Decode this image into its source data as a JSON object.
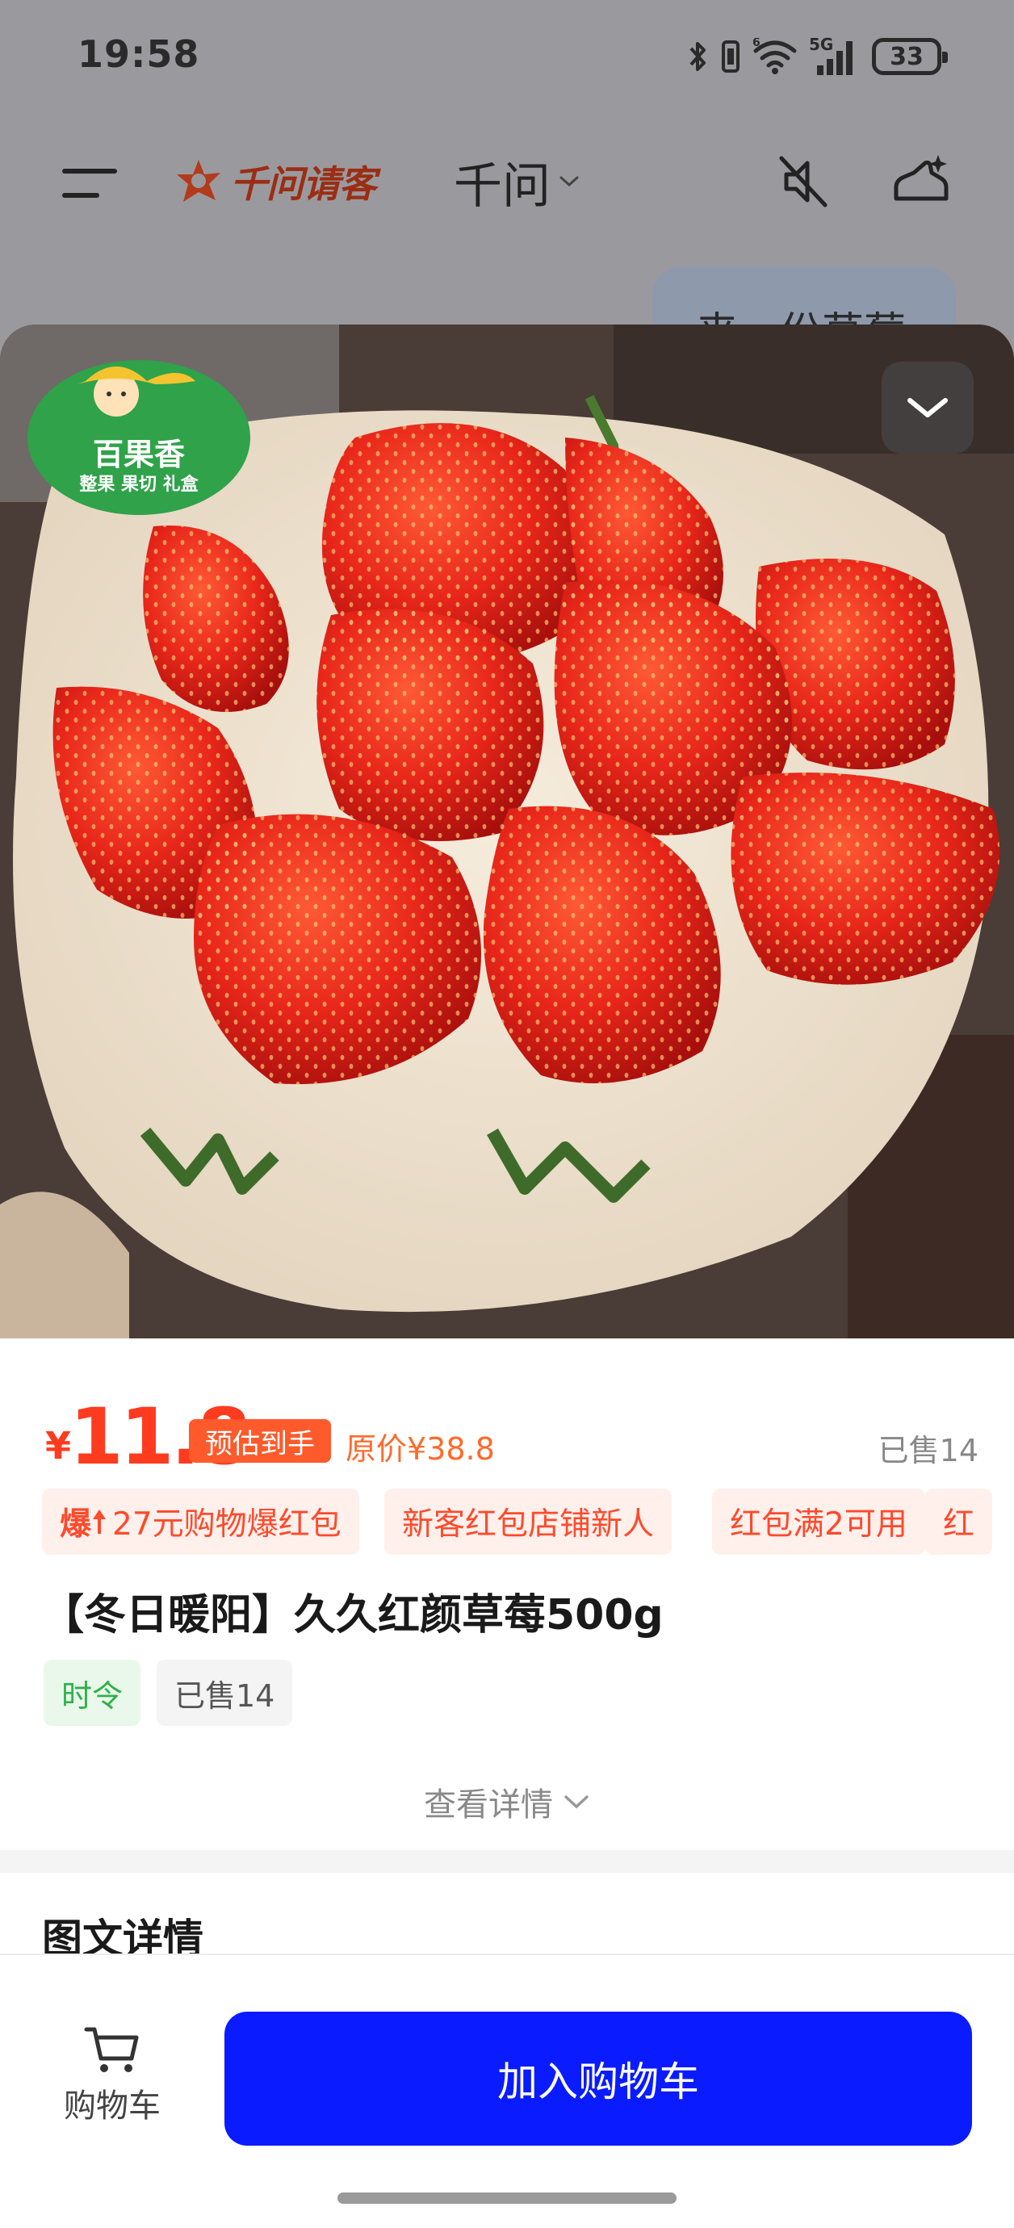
{
  "status_bar": {
    "time": "19:58",
    "network": "5G",
    "battery": "33"
  },
  "header": {
    "brand": "千问请客",
    "model": "千问",
    "chat_preview": "来一份草莓"
  },
  "product": {
    "shop_logo_text": "百果香",
    "shop_logo_subtext": "整果 果切 礼盒",
    "currency": "¥",
    "price": "11.8",
    "estimate_badge": "预估到手",
    "original_price": "原价¥38.8",
    "sold_count": "已售14",
    "coupons": [
      {
        "label": "27元购物爆红包",
        "hot_mark": "爆"
      },
      {
        "label": "新客红包店铺新人"
      },
      {
        "label": "红包满2可用"
      },
      {
        "label": "红"
      }
    ],
    "title": "【冬日暖阳】久久红颜草莓500g",
    "tags": [
      "时令",
      "已售14"
    ],
    "more_details": "查看详情",
    "section_title": "图文详情"
  },
  "bottom_bar": {
    "cart_label": "购物车",
    "add_to_cart": "加入购物车"
  },
  "colors": {
    "price_red": "#ff3b1f",
    "badge_orange": "#ff5a2b",
    "coupon_bg": "#fff0ec",
    "season_green": "#30b04a",
    "cta_blue": "#0a1cff",
    "overlay_gray": "#9a9a9e"
  },
  "icons": [
    "menu-icon",
    "brand-logo-icon",
    "chevron-down-icon",
    "mute-icon",
    "new-chat-icon",
    "collapse-chevron-icon",
    "cart-icon",
    "bluetooth-icon",
    "wifi-icon",
    "signal-icon"
  ]
}
